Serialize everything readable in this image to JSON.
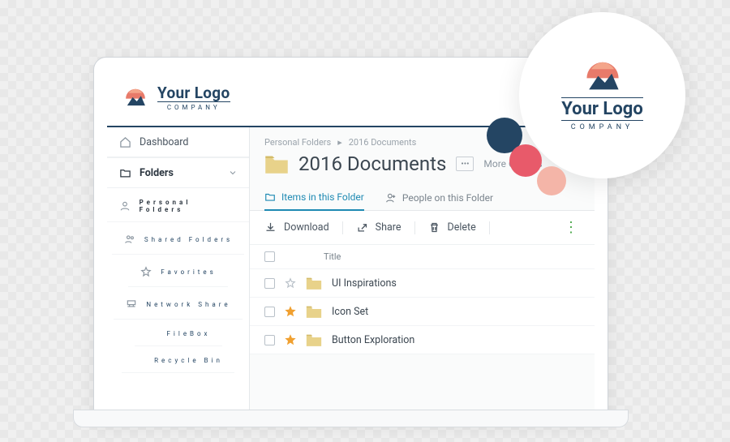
{
  "brand": {
    "name": "Your Logo",
    "tagline": "COMPANY"
  },
  "sidebar": {
    "dashboard": "Dashboard",
    "folders": "Folders",
    "personal": "Personal Folders",
    "shared": "Shared Folders",
    "favorites": "Favorites",
    "network": "Network Share",
    "filebox": "FileBox",
    "recycle": "Recycle Bin"
  },
  "breadcrumb": {
    "root": "Personal Folders",
    "current": "2016 Documents"
  },
  "page": {
    "title": "2016 Documents",
    "moreOptions": "More Options"
  },
  "tabs": {
    "items": "Items in this Folder",
    "people": "People on this Folder"
  },
  "actions": {
    "download": "Download",
    "share": "Share",
    "delete": "Delete"
  },
  "table": {
    "titleHeader": "Title"
  },
  "rows": [
    {
      "title": "UI Inspirations",
      "starred": false
    },
    {
      "title": "Icon Set",
      "starred": true
    },
    {
      "title": "Button Exploration",
      "starred": true
    }
  ],
  "palette": {
    "navy": "#244563",
    "coral": "#e85a6a",
    "peach": "#f4b5a8"
  }
}
